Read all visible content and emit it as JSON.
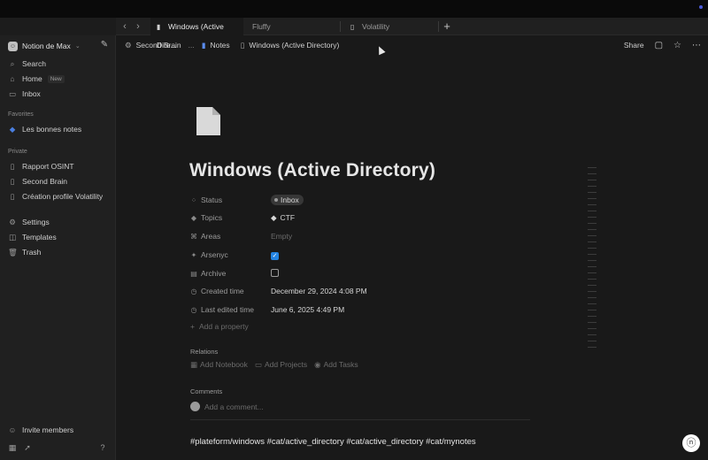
{
  "tabs": [
    {
      "label": "Windows (Active Dire..."
    },
    {
      "label": "Fluffy"
    },
    {
      "label": "Volatility"
    }
  ],
  "sidebar": {
    "workspace": "Notion de Max",
    "top_items": [
      {
        "label": "Search"
      },
      {
        "label": "Home",
        "badge": "New"
      },
      {
        "label": "Inbox"
      }
    ],
    "favorites_heading": "Favorites",
    "favorites": [
      {
        "label": "Les bonnes notes"
      }
    ],
    "private_heading": "Private",
    "private": [
      {
        "label": "Rapport OSINT"
      },
      {
        "label": "Second Brain"
      },
      {
        "label": "Création profile Volatility"
      }
    ],
    "utility": [
      {
        "label": "Settings"
      },
      {
        "label": "Templates"
      },
      {
        "label": "Trash"
      }
    ],
    "invite": "Invite members"
  },
  "breadcrumb": {
    "items": [
      "Second Brain",
      "...",
      "Notes",
      "Windows (Active Directory)"
    ]
  },
  "actions": {
    "share": "Share"
  },
  "page": {
    "title": "Windows (Active Directory)",
    "properties": [
      {
        "label": "Status",
        "value": "Inbox"
      },
      {
        "label": "Topics",
        "value": "CTF"
      },
      {
        "label": "Areas",
        "value": "Empty"
      },
      {
        "label": "Arsenyc",
        "checked": true
      },
      {
        "label": "Archive",
        "checked": false
      },
      {
        "label": "Created time",
        "value": "December 29, 2024 4:08 PM"
      },
      {
        "label": "Last edited time",
        "value": "June 6, 2025 4:49 PM"
      }
    ],
    "add_property": "Add a property",
    "relations_heading": "Relations",
    "relations": [
      "Add Notebook",
      "Add Projects",
      "Add Tasks"
    ],
    "comments_heading": "Comments",
    "comment_placeholder": "Add a comment...",
    "tags_line": "#plateform/windows #cat/active_directory #cat/active_directory #cat/mynotes"
  },
  "colors": {
    "accent": "#2383e2",
    "background": "#191919",
    "sidebar": "#202020"
  }
}
